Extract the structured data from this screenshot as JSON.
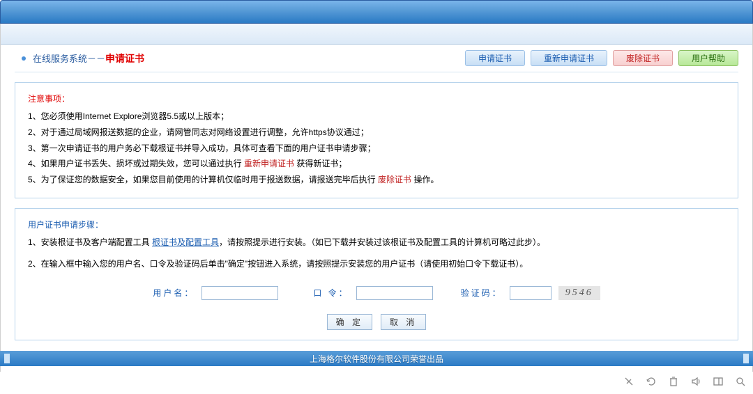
{
  "header": {
    "title_prefix": "在线服务系统－－",
    "title_main": "申请证书"
  },
  "nav": {
    "apply": "申请证书",
    "reapply": "重新申请证书",
    "revoke": "废除证书",
    "help": "用户帮助"
  },
  "notes": {
    "heading": "注意事项：",
    "n1": "1、您必须使用Internet Explore浏览器5.5或以上版本；",
    "n2": "2、对于通过局域网报送数据的企业，请网管同志对网络设置进行调整，允许https协议通过；",
    "n3": "3、第一次申请证书的用户务必下载根证书并导入成功，具体可查看下面的用户证书申请步骤；",
    "n4a": "4、如果用户证书丢失、损坏或过期失效，您可以通过执行 ",
    "n4link": "重新申请证书",
    "n4b": " 获得新证书；",
    "n5a": "5、为了保证您的数据安全，如果您目前使用的计算机仅临时用于报送数据，请报送完毕后执行 ",
    "n5link": "废除证书",
    "n5b": " 操作。"
  },
  "steps": {
    "heading": "用户证书申请步骤：",
    "s1a": "1、安装根证书及客户端配置工具 ",
    "s1link": "根证书及配置工具",
    "s1b": "，请按照提示进行安装。（如已下载并安装过该根证书及配置工具的计算机可略过此步）。",
    "s2": "2、在输入框中输入您的用户名、口令及验证码后单击\"确定\"按钮进入系统，请按照提示安装您的用户证书（请使用初始口令下载证书）。"
  },
  "form": {
    "username_label": "用户名：",
    "password_label": "口 令：",
    "captcha_label": "验证码：",
    "captcha_value": "9546",
    "ok": "确 定",
    "cancel": "取 消"
  },
  "footer": {
    "text": "上海格尔软件股份有限公司荣誉出品"
  }
}
